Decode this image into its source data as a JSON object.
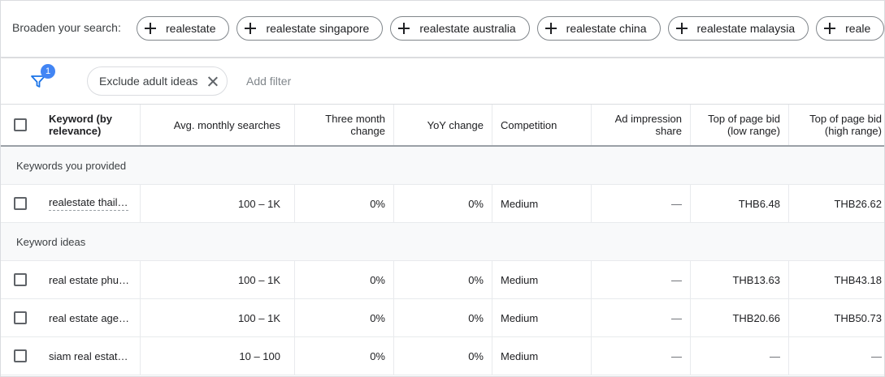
{
  "broaden": {
    "label": "Broaden your search:",
    "chips": [
      "realestate",
      "realestate singapore",
      "realestate australia",
      "realestate china",
      "realestate malaysia",
      "reale"
    ]
  },
  "filters": {
    "badge_count": "1",
    "chip_label": "Exclude adult ideas",
    "add_filter": "Add filter"
  },
  "table": {
    "headers": {
      "keyword": "Keyword (by relevance)",
      "avg_searches": "Avg. monthly searches",
      "three_month": "Three month change",
      "yoy": "YoY change",
      "competition": "Competition",
      "ad_impression": "Ad impression share",
      "bid_low": "Top of page bid (low range)",
      "bid_high": "Top of page bid (high range)"
    },
    "group_provided": "Keywords you provided",
    "provided_rows": [
      {
        "keyword": "realestate thail…",
        "avg": "100 – 1K",
        "three_month": "0%",
        "yoy": "0%",
        "competition": "Medium",
        "impression": "—",
        "bid_low": "THB6.48",
        "bid_high": "THB26.62"
      }
    ],
    "group_ideas": "Keyword ideas",
    "idea_rows": [
      {
        "keyword": "real estate phu…",
        "avg": "100 – 1K",
        "three_month": "0%",
        "yoy": "0%",
        "competition": "Medium",
        "impression": "—",
        "bid_low": "THB13.63",
        "bid_high": "THB43.18"
      },
      {
        "keyword": "real estate age…",
        "avg": "100 – 1K",
        "three_month": "0%",
        "yoy": "0%",
        "competition": "Medium",
        "impression": "—",
        "bid_low": "THB20.66",
        "bid_high": "THB50.73"
      },
      {
        "keyword": "siam real estat…",
        "avg": "10 – 100",
        "three_month": "0%",
        "yoy": "0%",
        "competition": "Medium",
        "impression": "—",
        "bid_low": "—",
        "bid_high": "—"
      }
    ]
  }
}
